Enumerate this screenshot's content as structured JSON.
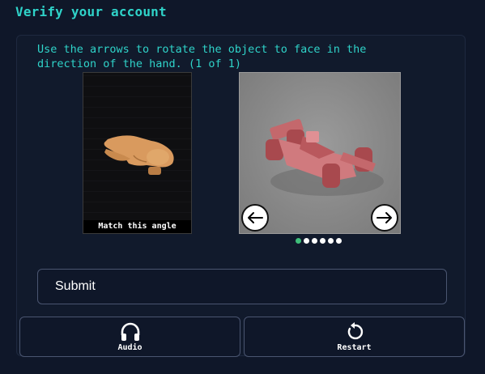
{
  "header": {
    "title": "Verify your account"
  },
  "challenge": {
    "instruction": "Use the arrows to rotate the object to face in the direction of the hand. (1 of 1)",
    "reference_caption": "Match this angle",
    "pager": {
      "total": 6,
      "current": 1
    }
  },
  "actions": {
    "submit_label": "Submit",
    "audio_label": "Audio",
    "restart_label": "Restart"
  },
  "colors": {
    "background": "#0f1729",
    "accent": "#2fd3c9",
    "active_dot": "#3fbf7a"
  },
  "icons": {
    "left_arrow": "arrow-left-icon",
    "right_arrow": "arrow-right-icon",
    "audio": "headphones-icon",
    "restart": "restart-icon"
  }
}
